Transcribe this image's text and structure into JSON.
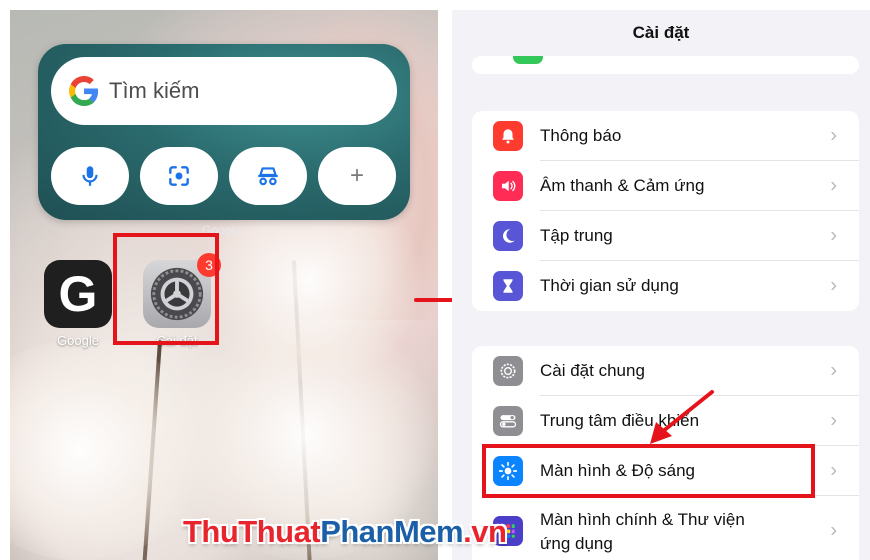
{
  "home": {
    "search_placeholder": "Tìm kiếm",
    "widget_label": "Google",
    "widget_buttons": [
      "microphone",
      "lens",
      "incognito",
      "+"
    ],
    "apps": [
      {
        "label": "Google",
        "icon": "google-g-icon"
      },
      {
        "label": "Cài đặt",
        "icon": "gear-icon",
        "badge": "3"
      }
    ]
  },
  "settings": {
    "title": "Cài đặt",
    "group1": [
      {
        "label": "Thông báo",
        "icon": "bell-icon",
        "color": "#ff3b30"
      },
      {
        "label": "Âm thanh & Cảm ứng",
        "icon": "speaker-icon",
        "color": "#ff2d55"
      },
      {
        "label": "Tập trung",
        "icon": "moon-icon",
        "color": "#5856d6"
      },
      {
        "label": "Thời gian sử dụng",
        "icon": "hourglass-icon",
        "color": "#5856d6"
      }
    ],
    "group2": [
      {
        "label": "Cài đặt chung",
        "icon": "gear-icon",
        "color": "#8e8e93"
      },
      {
        "label": "Trung tâm điều khiển",
        "icon": "toggles-icon",
        "color": "#8e8e93"
      },
      {
        "label": "Màn hình & Độ sáng",
        "icon": "sun-icon",
        "color": "#0a84ff"
      },
      {
        "label_line1": "Màn hình chính & Thư viện",
        "label_line2": "ứng dụng",
        "icon": "grid-icon",
        "color": "#4b3ec8"
      }
    ]
  },
  "watermark": {
    "part1": "ThuThuat",
    "part2": "PhanMem",
    "part3": ".vn"
  },
  "colors": {
    "highlight": "#e5141a",
    "google_blue": "#1a73e8"
  }
}
